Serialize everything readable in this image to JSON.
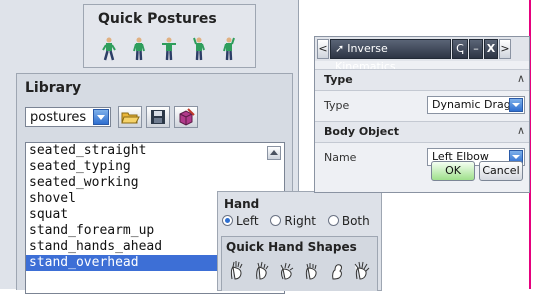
{
  "quick_postures": {
    "title": "Quick Postures",
    "figures": [
      "posture-figure-1",
      "posture-figure-2",
      "posture-figure-3",
      "posture-figure-4",
      "posture-figure-5"
    ]
  },
  "library": {
    "title": "Library",
    "selected_category": "postures",
    "toolbar": {
      "open_icon": "open-folder-icon",
      "save_icon": "save-disk-icon",
      "delete_icon": "delete-icon"
    },
    "items": [
      "seated_straight",
      "seated_typing",
      "seated_working",
      "shovel",
      "squat",
      "stand_forearm_up",
      "stand_hands_ahead",
      "stand_overhead"
    ],
    "selected_item": "stand_overhead"
  },
  "hand": {
    "title": "Hand",
    "options": [
      "Left",
      "Right",
      "Both"
    ],
    "selected": "Left",
    "quick_shapes_title": "Quick Hand Shapes",
    "shapes": [
      "hand-shape-1",
      "hand-shape-2",
      "hand-shape-3",
      "hand-shape-4",
      "hand-shape-5",
      "hand-shape-6"
    ]
  },
  "inverse_kinematics": {
    "nav_left": "<",
    "title": "Inverse Kinematics",
    "tab_controls": [
      "ↅ",
      "–",
      "X"
    ],
    "nav_right": ">",
    "sections": [
      {
        "header": "Type",
        "row_label": "Type",
        "value": "Dynamic Drag"
      },
      {
        "header": "Body Object",
        "row_label": "Name",
        "value": "Left Elbow"
      }
    ],
    "ok_label": "OK",
    "cancel_label": "Cancel"
  },
  "colors": {
    "accent": "#e6007e",
    "selection": "#3d6fd6",
    "ok_green": "#9fe08b"
  }
}
